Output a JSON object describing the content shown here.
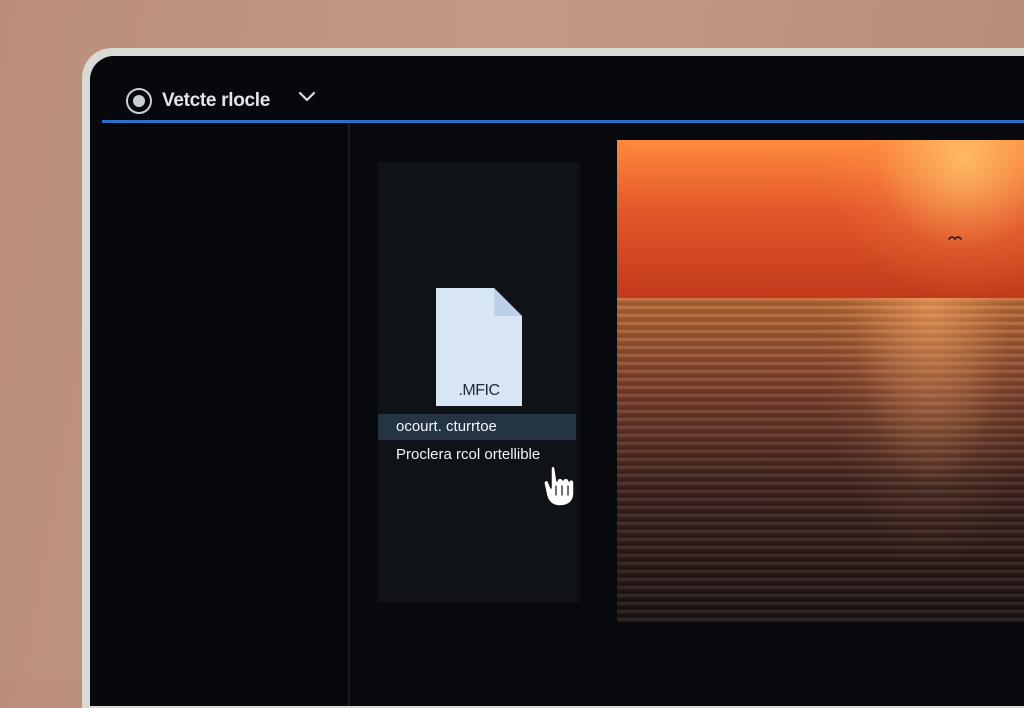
{
  "app": {
    "title": "Vetcte rlocle"
  },
  "file_panel": {
    "file_icon": "file-icon",
    "file_extension": ".MFIC",
    "menu_items": [
      {
        "label": "ocourt. cturrtoe"
      },
      {
        "label": "Proclera rcol ortellible"
      }
    ]
  }
}
